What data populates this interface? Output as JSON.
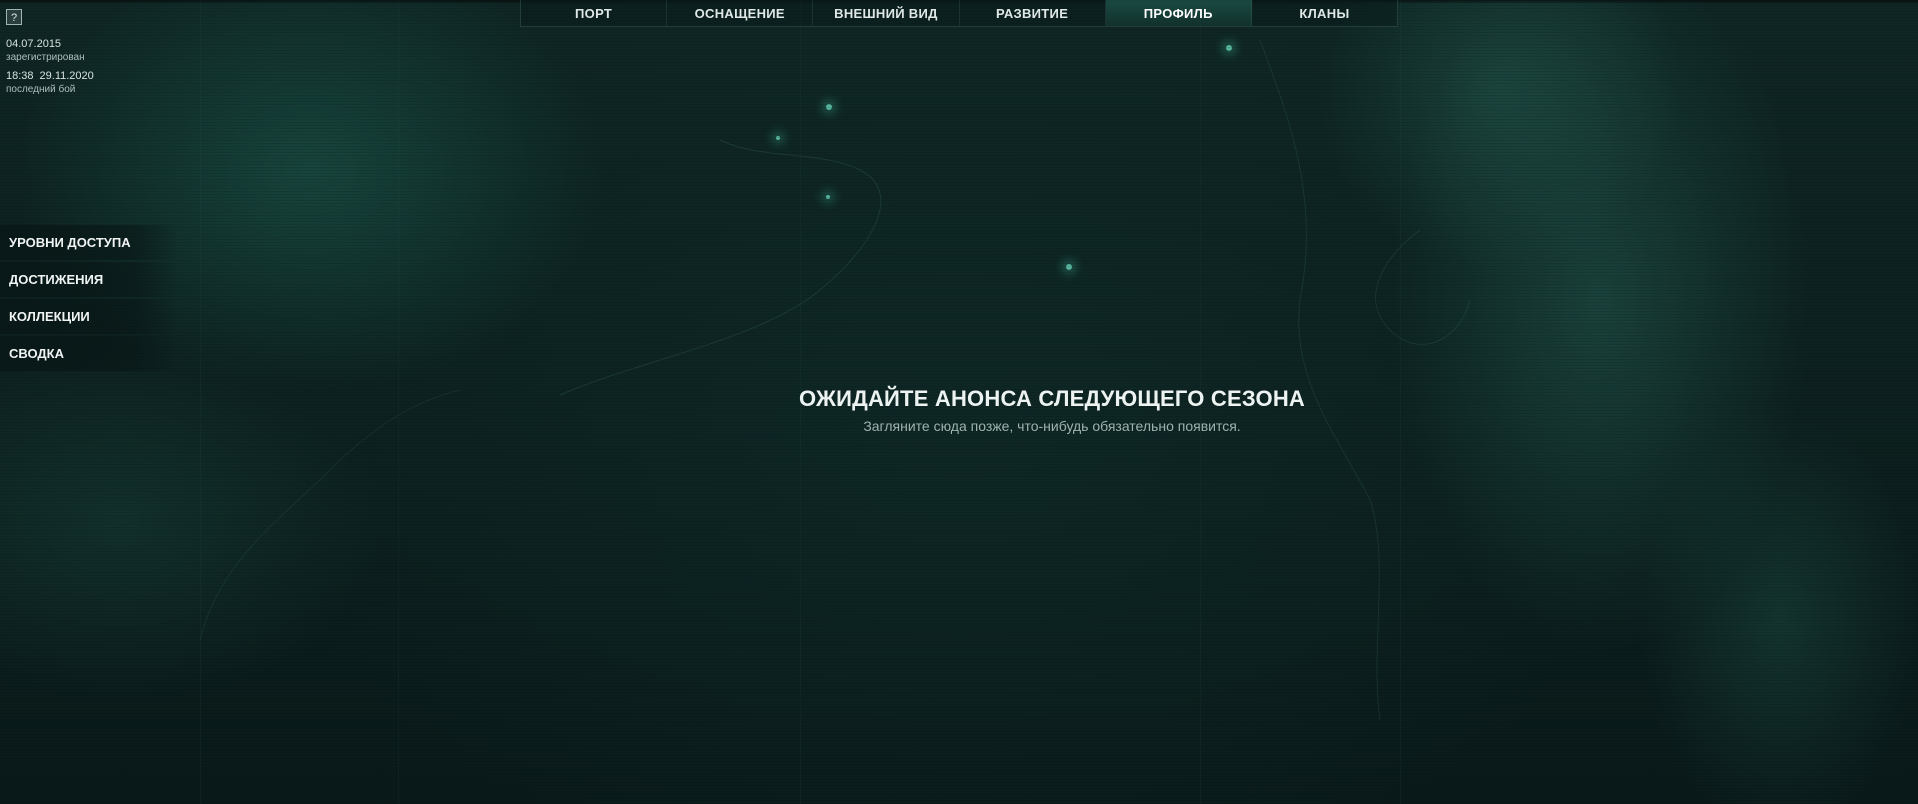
{
  "nav": {
    "items": [
      {
        "label": "ПОРТ"
      },
      {
        "label": "ОСНАЩЕНИЕ"
      },
      {
        "label": "ВНЕШНИЙ ВИД"
      },
      {
        "label": "РАЗВИТИЕ"
      },
      {
        "label": "ПРОФИЛЬ",
        "active": true
      },
      {
        "label": "КЛАНЫ"
      }
    ]
  },
  "help": {
    "icon": "question-icon",
    "glyph": "?"
  },
  "player": {
    "registered_date": "04.07.2015",
    "registered_label": "зарегистрирован",
    "last_battle_time": "18:38",
    "last_battle_date": "29.11.2020",
    "last_battle_label": "последний бой"
  },
  "side_menu": {
    "items": [
      {
        "label": "УРОВНИ ДОСТУПА"
      },
      {
        "label": "ДОСТИЖЕНИЯ"
      },
      {
        "label": "КОЛЛЕКЦИИ"
      },
      {
        "label": "СВОДКА"
      }
    ]
  },
  "message": {
    "title": "ОЖИДАЙТЕ АНОНСА СЛЕДУЮЩЕГО СЕЗОНА",
    "subtitle": "Загляните сюда позже, что-нибудь обязательно появится."
  },
  "colors": {
    "background": "#0b1c1c",
    "accent": "#2a6e60",
    "text": "#e6eeec"
  }
}
